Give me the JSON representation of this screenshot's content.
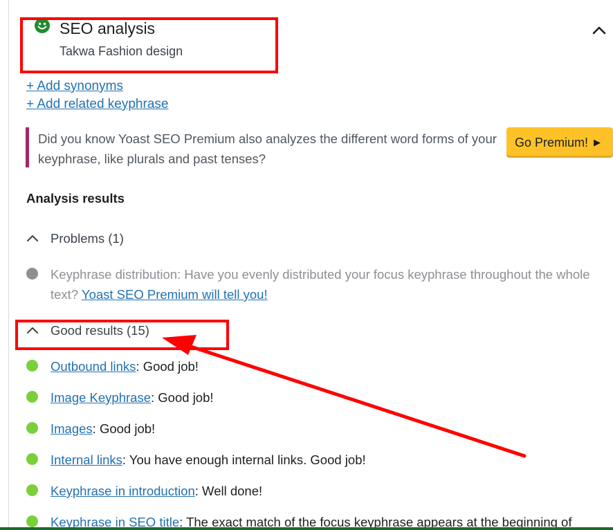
{
  "seo": {
    "title": "SEO analysis",
    "subtitle": "Takwa Fashion design"
  },
  "links": {
    "synonyms": "+ Add synonyms",
    "related": "+ Add related keyphrase"
  },
  "premium": {
    "text": "Did you know Yoast SEO Premium also analyzes the different word forms of your keyphrase, like plurals and past tenses?",
    "button": "Go Premium!",
    "button_arrow": "▶"
  },
  "analysis": {
    "heading": "Analysis results",
    "problems": {
      "label": "Problems (1)",
      "items": [
        {
          "text": "Keyphrase distribution: Have you evenly distributed your focus keyphrase throughout the whole text? ",
          "link": "Yoast SEO Premium will tell you!"
        }
      ]
    },
    "good": {
      "label": "Good results (15)",
      "items": [
        {
          "link": "Outbound links",
          "text": ": Good job!"
        },
        {
          "link": "Image Keyphrase",
          "text": ": Good job!"
        },
        {
          "link": "Images",
          "text": ": Good job!"
        },
        {
          "link": "Internal links",
          "text": ": You have enough internal links. Good job!"
        },
        {
          "link": "Keyphrase in introduction",
          "text": ": Well done!"
        },
        {
          "link": "Keyphrase in SEO title",
          "text": ": The exact match of the focus keyphrase appears at the beginning of"
        }
      ]
    }
  },
  "colors": {
    "good": "#7ad03a",
    "problem": "#8c8f94",
    "smiley": "#1e8c2e",
    "annotation": "#ff0000",
    "premium_bar": "#a4286a",
    "premium_button": "#fec228"
  }
}
